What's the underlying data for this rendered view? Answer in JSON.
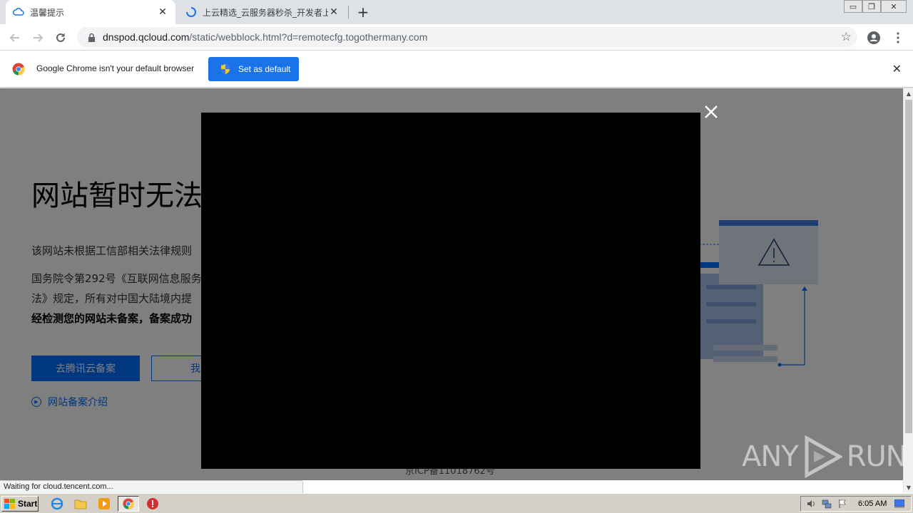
{
  "tabs": [
    {
      "title": "温馨提示",
      "active": true
    },
    {
      "title": "上云精选_云服务器秒杀_开发者上云",
      "active": false
    }
  ],
  "toolbar": {
    "url_host": "dnspod.qcloud.com",
    "url_rest": "/static/webblock.html?d=remotecfg.togothermany.com"
  },
  "infobar": {
    "message": "Google Chrome isn't your default browser",
    "button_label": "Set as default"
  },
  "page": {
    "heading": "网站暂时无法",
    "p1": "该网站未根据工信部相关法律规则",
    "p2": "国务院令第292号《互联网信息服务",
    "p3": "法》规定，所有对中国大陆境内提",
    "p4": "经检测您的网站未备案，备案成功",
    "primary_button": "去腾讯云备案",
    "secondary_button": "我已经",
    "intro_link": "网站备案介绍",
    "footer_icp": "京ICP备11018762号"
  },
  "status": {
    "text": "Waiting for cloud.tencent.com..."
  },
  "watermark": {
    "left": "ANY",
    "right": "RUN"
  },
  "taskbar": {
    "start_label": "Start",
    "clock": "6:05 AM"
  },
  "colors": {
    "accent": "#006eff",
    "chrome_blue": "#1a73e8",
    "overlay": "#000000"
  }
}
